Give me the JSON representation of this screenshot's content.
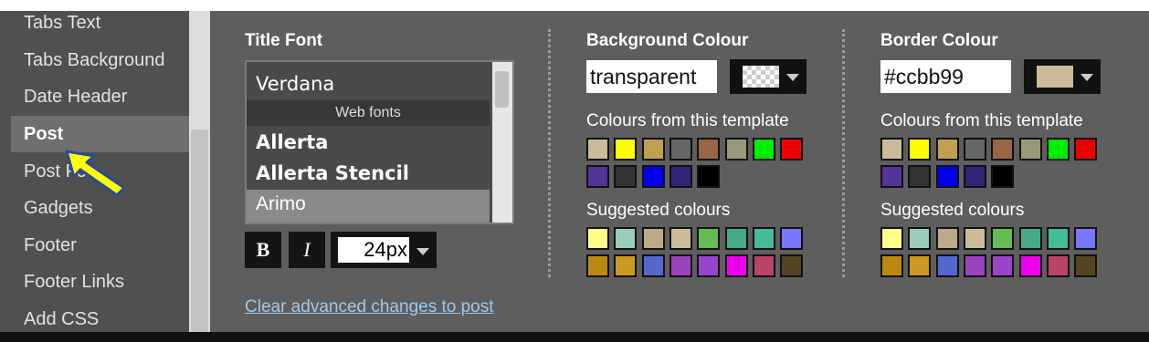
{
  "sidebar": {
    "items": [
      {
        "label": "Tabs Text"
      },
      {
        "label": "Tabs Background"
      },
      {
        "label": "Date Header"
      },
      {
        "label": "Post",
        "selected": true
      },
      {
        "label": "Post Foo"
      },
      {
        "label": "Gadgets"
      },
      {
        "label": "Footer"
      },
      {
        "label": "Footer Links"
      },
      {
        "label": "Add CSS"
      }
    ]
  },
  "title_font": {
    "heading": "Title Font",
    "options": [
      "Verdana",
      "Allerta",
      "Allerta Stencil",
      "Arimo"
    ],
    "web_fonts_header": "Web fonts",
    "selected": "Arimo",
    "bold_label": "B",
    "italic_label": "I",
    "size": "24px"
  },
  "clear_link": "Clear advanced changes to post",
  "background_colour": {
    "heading": "Background Colour",
    "value": "transparent",
    "preview": "transparent",
    "template_label": "Colours from this template",
    "suggested_label": "Suggested colours"
  },
  "border_colour": {
    "heading": "Border Colour",
    "value": "#ccbb99",
    "preview": "#ccbb99",
    "template_label": "Colours from this template",
    "suggested_label": "Suggested colours"
  },
  "template_colours": [
    [
      "#ccbb99",
      "#ffff00",
      "#c0a050",
      "#666666",
      "#996644",
      "#999977",
      "#00ee00",
      "#ee0000"
    ],
    [
      "#553399",
      "#333333",
      "#0000ee",
      "#332277",
      "#000000"
    ]
  ],
  "suggested_colours": [
    [
      "#ffff88",
      "#99ccbb",
      "#bbaa88",
      "#ccbb99",
      "#66bb55",
      "#44aa88",
      "#44bb99",
      "#7777ff"
    ],
    [
      "#bb8811",
      "#cc9922",
      "#5566cc",
      "#9944bb",
      "#9944cc",
      "#ee00ee",
      "#bb4466",
      "#554422"
    ]
  ]
}
